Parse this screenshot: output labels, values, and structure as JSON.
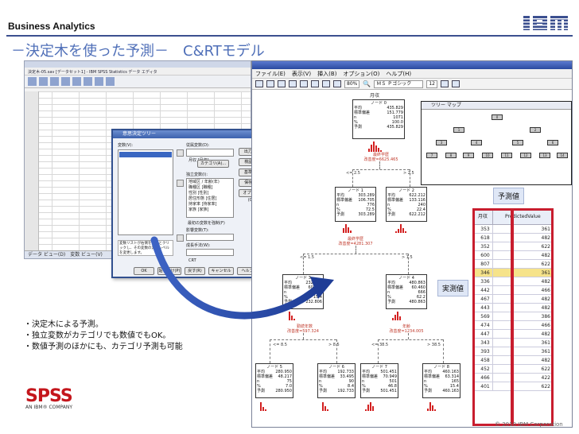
{
  "header": {
    "label": "Business Analytics",
    "logo_text": "IBM"
  },
  "slide": {
    "title": "－決定木を使った予測－　C&RTモデル"
  },
  "tree_window": {
    "menu": [
      "ファイル(E)",
      "表示(V)",
      "挿入(B)",
      "オプション(O)",
      "ヘルプ(H)"
    ],
    "zoom": "80%",
    "font": "ＭＳ Ｐゴシック",
    "font_size": "12",
    "root_label": "月収",
    "nodes": [
      {
        "id": "node-0",
        "title": "ノード 0",
        "rows": [
          [
            "平均",
            "435.829"
          ],
          [
            "標準偏差",
            "151.779"
          ],
          [
            "n",
            "1071"
          ],
          [
            "%",
            "100.0"
          ],
          [
            "予測",
            "435.829"
          ]
        ]
      },
      {
        "id": "node-1",
        "title": "ノード 1",
        "rows": [
          [
            "平均",
            "303.289"
          ],
          [
            "標準偏差",
            "106.705"
          ],
          [
            "n",
            "776"
          ],
          [
            "%",
            "72.5"
          ],
          [
            "予測",
            "303.289"
          ]
        ]
      },
      {
        "id": "node-2",
        "title": "ノード 2",
        "rows": [
          [
            "平均",
            "622.212"
          ],
          [
            "標準偏差",
            "133.116"
          ],
          [
            "n",
            "240"
          ],
          [
            "%",
            "22.4"
          ],
          [
            "予測",
            "622.212"
          ]
        ]
      },
      {
        "id": "node-3",
        "title": "ノード 3",
        "rows": [
          [
            "平均",
            "232.806"
          ],
          [
            "標準偏差",
            "60.282"
          ],
          [
            "n",
            "165"
          ],
          [
            "%",
            "15.4"
          ],
          [
            "予測",
            "232.806"
          ]
        ]
      },
      {
        "id": "node-4",
        "title": "ノード 4",
        "rows": [
          [
            "平均",
            "480.863"
          ],
          [
            "標準偏差",
            "60.460"
          ],
          [
            "n",
            "666"
          ],
          [
            "%",
            "62.2"
          ],
          [
            "予測",
            "480.863"
          ]
        ]
      },
      {
        "id": "node-5",
        "title": "ノード 5",
        "rows": [
          [
            "平均",
            "280.950"
          ],
          [
            "標準偏差",
            "48.217"
          ],
          [
            "n",
            "75"
          ],
          [
            "%",
            "7.0"
          ],
          [
            "予測",
            "280.950"
          ]
        ]
      },
      {
        "id": "node-6",
        "title": "ノード 6",
        "rows": [
          [
            "平均",
            "192.733"
          ],
          [
            "標準偏差",
            "33.495"
          ],
          [
            "n",
            "90"
          ],
          [
            "%",
            "8.4"
          ],
          [
            "予測",
            "192.733"
          ]
        ]
      },
      {
        "id": "node-7",
        "title": "ノード 7",
        "rows": [
          [
            "平均",
            "501.451"
          ],
          [
            "標準偏差",
            "70.949"
          ],
          [
            "n",
            "501"
          ],
          [
            "%",
            "46.8"
          ],
          [
            "予測",
            "501.451"
          ]
        ]
      },
      {
        "id": "node-8",
        "title": "ノード 8",
        "rows": [
          [
            "平均",
            "460.163"
          ],
          [
            "標準偏差",
            "63.314"
          ],
          [
            "n",
            "165"
          ],
          [
            "%",
            "15.4"
          ],
          [
            "予測",
            "460.163"
          ]
        ]
      }
    ],
    "splits": [
      {
        "id": "split-root",
        "var": "最終学歴",
        "stat": "改善度=6625.465"
      },
      {
        "id": "split-1",
        "var": "最終学歴",
        "stat": "改善度=4281.307"
      },
      {
        "id": "split-3",
        "var": "勤続年数",
        "stat": "改善度=597.324"
      },
      {
        "id": "split-4",
        "var": "年齢",
        "stat": "改善度=1234.005"
      }
    ],
    "conditions": [
      "<= 2.5",
      "> 2.5",
      "<= 1.5",
      "> 1.5",
      "<= 8.5",
      "> 8.5",
      "<= 38.5",
      "> 38.5"
    ],
    "minimap_title": "ツリー マップ",
    "minimap_labels": [
      "0",
      "1",
      "2",
      "3",
      "4",
      "5",
      "6",
      "7",
      "8",
      "9",
      "10",
      "11",
      "12",
      "13",
      "14"
    ]
  },
  "prediction_table": {
    "headers": [
      "月収",
      "PredictedValue"
    ],
    "rows": [
      [
        "353",
        "361"
      ],
      [
        "618",
        "482"
      ],
      [
        "352",
        "622"
      ],
      [
        "600",
        "482"
      ],
      [
        "807",
        "622"
      ],
      [
        "346",
        "361"
      ],
      [
        "336",
        "482"
      ],
      [
        "442",
        "466"
      ],
      [
        "467",
        "482"
      ],
      [
        "443",
        "482"
      ],
      [
        "569",
        "386"
      ],
      [
        "474",
        "466"
      ],
      [
        "447",
        "482"
      ],
      [
        "343",
        "361"
      ],
      [
        "393",
        "361"
      ],
      [
        "458",
        "482"
      ],
      [
        "452",
        "622"
      ],
      [
        "466",
        "422"
      ],
      [
        "401",
        "622"
      ]
    ],
    "highlight_row": 5
  },
  "callouts": {
    "predicted": "予測値",
    "actual": "実測値"
  },
  "bullets": [
    "・決定木による予測。",
    "・独立変数がカテゴリでも数値でもOK。",
    "・数値予測のほかにも、カテゴリ予測も可能"
  ],
  "data_window": {
    "tabs": "データ ビュー(D)　変数 ビュー(V)",
    "title": "決定木-05.sav [データセット1] - IBM SPSS Statistics データ エディタ"
  },
  "dialog": {
    "title": "意思決定ツリー",
    "vars_label": "変数(V):",
    "vars_item": "お客様番号 [顧客番号]",
    "dep_label": "従属変数(D):",
    "dep_value": "月収 [月収]",
    "indep_label": "独立変数(I):",
    "indep_items": [
      "地域区 / 年齢(年)",
      "職種区 [職種]",
      "性別 [性別]",
      "居住形態 [住居]",
      "持家率 [持家率]",
      "家族 [家族]"
    ],
    "force_label": "最初の変数を強制(F)",
    "influence_label": "影響変数(T):",
    "method_label": "成長手法(W):",
    "method_value": "CRT",
    "side_buttons": [
      "出力(U)...",
      "検証(L)...",
      "基準(C)...",
      "保存(S)...",
      "オプション(O)..."
    ],
    "note": "変数リストが右側を見るとクリックし、その変数の測定レベルを変更します。",
    "category_button": "カテゴリ(A)...",
    "bottom_buttons": [
      "OK",
      "貼り付け(P)",
      "戻す(R)",
      "キャンセル",
      "ヘルプ"
    ]
  },
  "brand": {
    "spss": "SPSS",
    "spss_sub": "AN IBM® COMPANY",
    "copyright": "© 2010 IBM Corporation"
  },
  "colors": {
    "title_blue": "#4f6fb8",
    "rule": "#3b4f8f",
    "highlight_red": "#c81d2e",
    "histogram": "#d32020",
    "arrow": "#1f45a8"
  }
}
